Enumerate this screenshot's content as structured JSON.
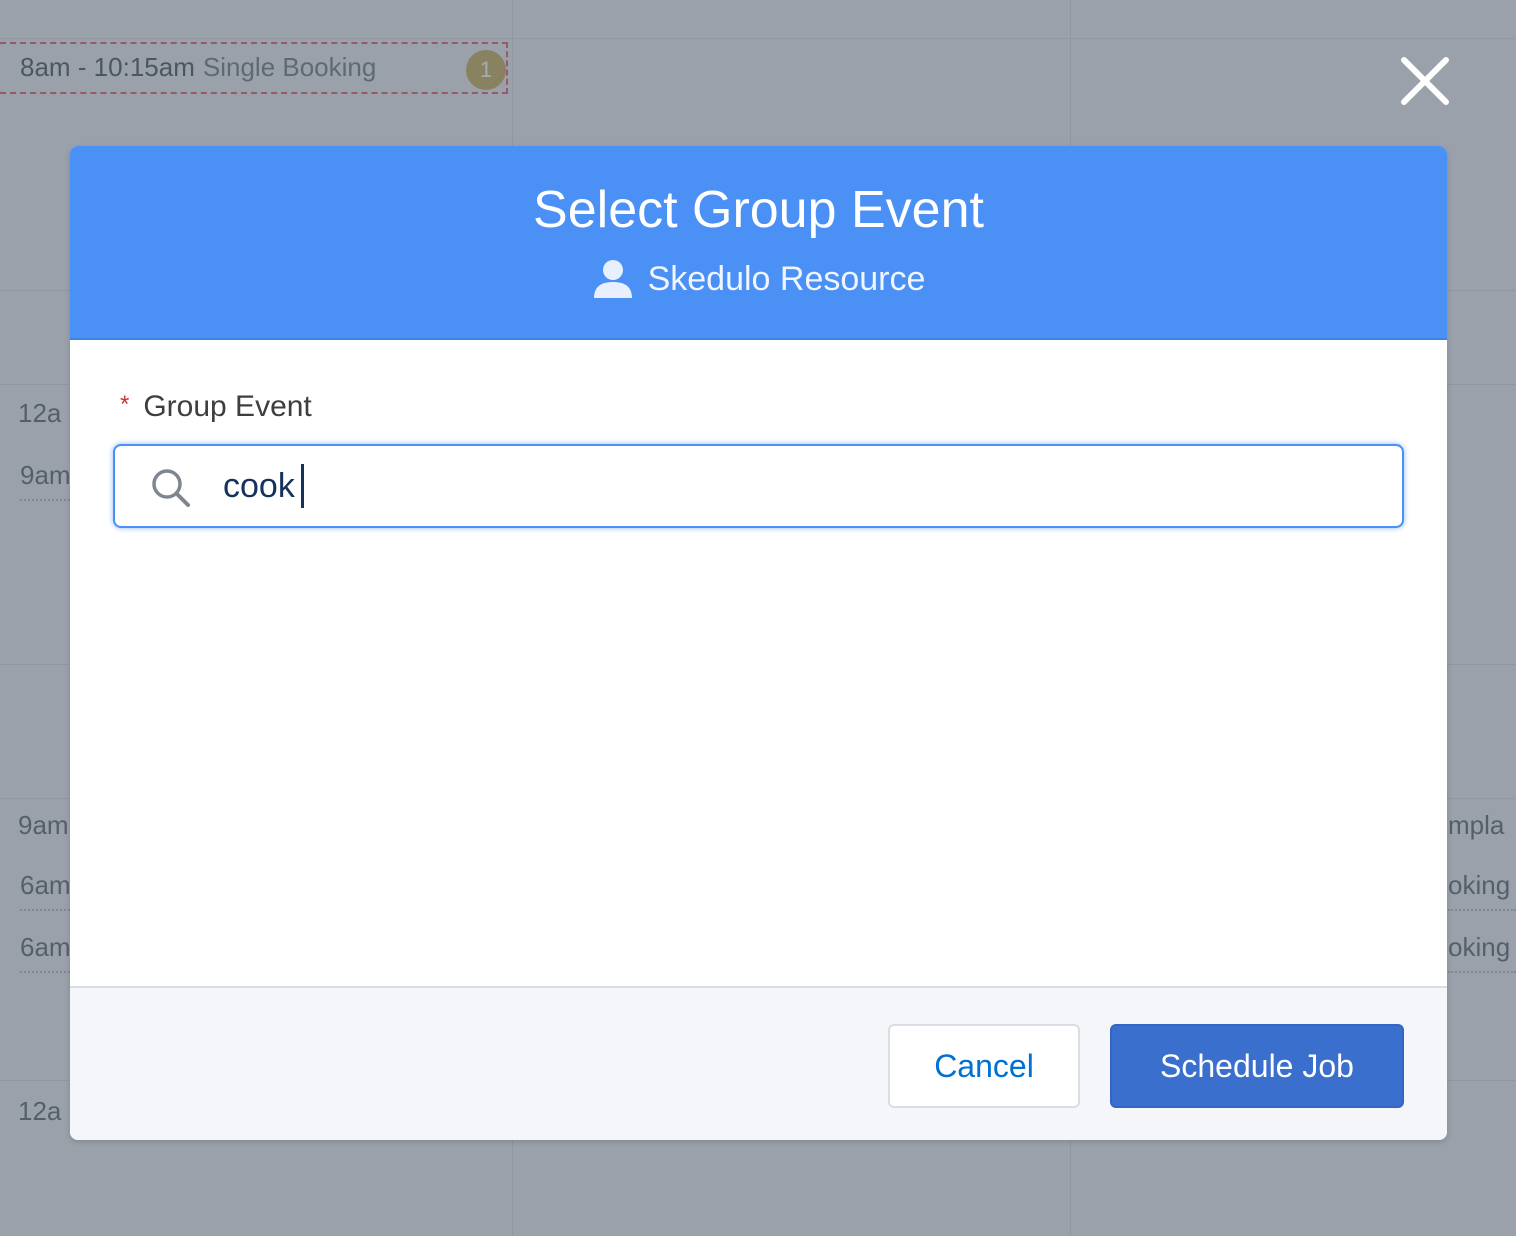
{
  "background": {
    "booking": {
      "time": "8am - 10:15am",
      "label": "Single Booking",
      "count": "1"
    },
    "left_labels": [
      "12a",
      "9am",
      "9am",
      "6am",
      "6am",
      "12a"
    ],
    "right_labels": [
      "mpla",
      "oking",
      "oking"
    ]
  },
  "modal": {
    "title": "Select Group Event",
    "subtitle": "Skedulo Resource",
    "subtitle_icon": "person-icon",
    "field": {
      "required_marker": "*",
      "label": "Group Event",
      "value": "cook"
    },
    "footer": {
      "cancel_label": "Cancel",
      "primary_label": "Schedule Job"
    }
  },
  "colors": {
    "header": "#4b90f4",
    "primary_button": "#3a6fce",
    "link": "#0070d2",
    "required": "#c23934"
  }
}
